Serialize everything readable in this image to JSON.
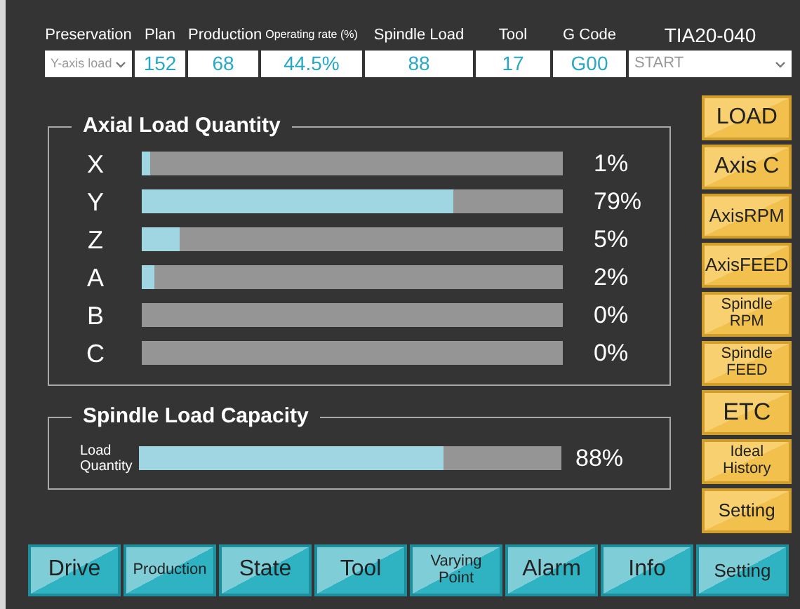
{
  "header": {
    "fields": [
      {
        "label": "Preservation",
        "value": "Y-axis load",
        "kind": "dropdown"
      },
      {
        "label": "Plan",
        "value": "152",
        "kind": "value"
      },
      {
        "label": "Production",
        "value": "68",
        "kind": "value"
      },
      {
        "label": "Operating rate (%)",
        "value": "44.5%",
        "kind": "value"
      },
      {
        "label": "Spindle Load",
        "value": "88",
        "kind": "value"
      },
      {
        "label": "Tool",
        "value": "17",
        "kind": "value"
      },
      {
        "label": "G Code",
        "value": "G00",
        "kind": "value"
      },
      {
        "label": "TIA20-040",
        "value": "START",
        "kind": "dropdown"
      }
    ]
  },
  "axial_load": {
    "title": "Axial Load Quantity",
    "axes": [
      {
        "name": "X",
        "level": 0.02,
        "reading": "1%"
      },
      {
        "name": "Y",
        "level": 0.74,
        "reading": "79%"
      },
      {
        "name": "Z",
        "level": 0.09,
        "reading": "5%"
      },
      {
        "name": "A",
        "level": 0.03,
        "reading": "2%"
      },
      {
        "name": "B",
        "level": 0,
        "reading": "0%"
      },
      {
        "name": "C",
        "level": 0,
        "reading": "0%"
      }
    ]
  },
  "spindle_load": {
    "title": "Spindle Load Capacity",
    "label": "Load Quantity",
    "level": 0.72,
    "reading": "88%"
  },
  "side_buttons": [
    "LOAD",
    "Axis C",
    "AxisRPM",
    "AxisFEED",
    "Spindle RPM",
    "Spindle FEED",
    "ETC",
    "Ideal History",
    "Setting"
  ],
  "bottom_buttons": [
    "Drive",
    "Production",
    "State",
    "Tool",
    "Varying Point",
    "Alarm",
    "Info",
    "Setting"
  ]
}
